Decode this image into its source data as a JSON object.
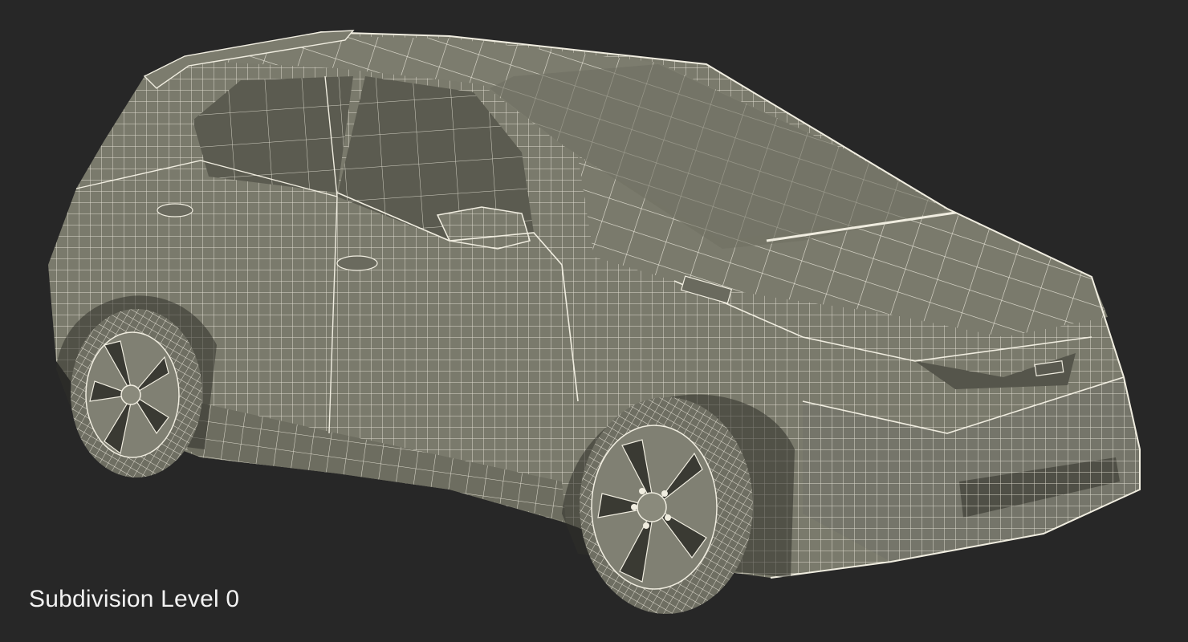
{
  "viewport": {
    "background_color": "#272727"
  },
  "model": {
    "subject": "car",
    "render_style": "wireframe",
    "surface_color": "#7a7a6c",
    "surface_shadow_color": "#5a5a50",
    "glass_color": "#5b5b50",
    "wire_color": "#f0ede0"
  },
  "caption": {
    "text": "Subdivision Level 0"
  }
}
